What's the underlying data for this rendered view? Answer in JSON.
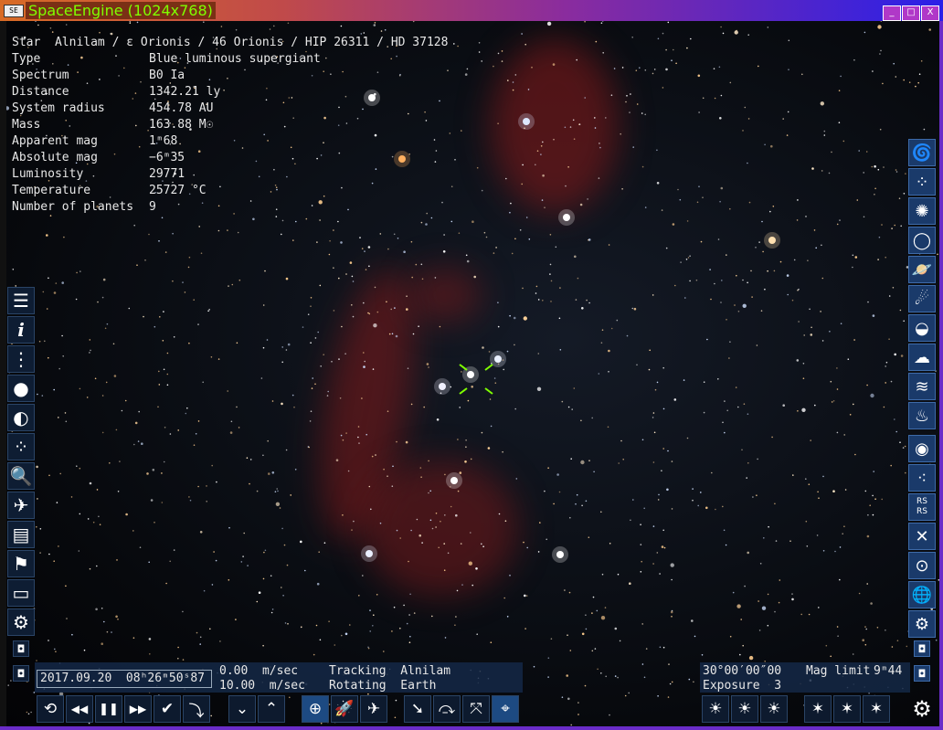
{
  "window": {
    "title": "SpaceEngine (1024x768)",
    "buttons": [
      "_",
      "□",
      "X"
    ]
  },
  "object_info": {
    "name_line": "Star  Alnilam / ε Orionis / 46 Orionis / HIP 26311 / HD 37128",
    "rows": [
      {
        "label": "Type",
        "value": "Blue luminous supergiant"
      },
      {
        "label": "Spectrum",
        "value": "B0 Ia"
      },
      {
        "label": "Distance",
        "value": "1342.21 ly"
      },
      {
        "label": "System radius",
        "value": "454.78 AU"
      },
      {
        "label": "Mass",
        "value": "163.88 M☉"
      },
      {
        "label": "Apparent mag",
        "value": "1ᵐ68"
      },
      {
        "label": "Absolute mag",
        "value": "−6ᵐ35"
      },
      {
        "label": "Luminosity",
        "value": "29771"
      },
      {
        "label": "Temperature",
        "value": "25727 °C"
      },
      {
        "label": "Number of planets",
        "value": "9"
      }
    ]
  },
  "left_toolbar": [
    {
      "name": "menu-icon",
      "glyph": "☰"
    },
    {
      "name": "info-icon",
      "glyph": "i"
    },
    {
      "name": "planetarium-icon",
      "glyph": "⋮"
    },
    {
      "name": "solar-system-browser-icon",
      "glyph": "●"
    },
    {
      "name": "star-browser-icon",
      "glyph": "◐"
    },
    {
      "name": "star-field-icon",
      "glyph": "⁘"
    },
    {
      "name": "search-icon",
      "glyph": "🔍"
    },
    {
      "name": "spaceship-icon",
      "glyph": "✈"
    },
    {
      "name": "calendar-icon",
      "glyph": "▤"
    },
    {
      "name": "flag-icon",
      "glyph": "⚑"
    },
    {
      "name": "display-icon",
      "glyph": "▭"
    },
    {
      "name": "settings-icon",
      "glyph": "⚙"
    },
    {
      "name": "small-toggle-icon",
      "glyph": "◘"
    },
    {
      "name": "small-toggle-icon-2",
      "glyph": "◘"
    }
  ],
  "right_toolbar": [
    {
      "name": "galaxies-icon",
      "glyph": "🌀"
    },
    {
      "name": "star-clusters-icon",
      "glyph": "⁘"
    },
    {
      "name": "nebulae-icon",
      "glyph": "✺"
    },
    {
      "name": "ring-icon",
      "glyph": "◯"
    },
    {
      "name": "planet-rings-icon",
      "glyph": "🪐"
    },
    {
      "name": "comet-icon",
      "glyph": "☄"
    },
    {
      "name": "atmosphere-icon",
      "glyph": "◒"
    },
    {
      "name": "clouds-icon",
      "glyph": "☁"
    },
    {
      "name": "water-icon",
      "glyph": "≋"
    },
    {
      "name": "aurora-icon",
      "glyph": "♨"
    },
    {
      "name": "eye-icon",
      "glyph": "◉"
    },
    {
      "name": "dots-icon",
      "glyph": "⁖"
    },
    {
      "name": "labels-icon",
      "glyph": "•"
    },
    {
      "name": "collapse-icon",
      "glyph": "✕"
    },
    {
      "name": "orbit-icon",
      "glyph": "⊙"
    },
    {
      "name": "grid-globe-icon",
      "glyph": "🌐"
    },
    {
      "name": "settings-icon",
      "glyph": "⚙"
    },
    {
      "name": "small-toggle-icon",
      "glyph": "◘"
    },
    {
      "name": "small-toggle-icon-2",
      "glyph": "◘"
    }
  ],
  "right_toolbar_rs": [
    "RS",
    "RS"
  ],
  "bottom_panel": {
    "date": "2017.09.20  08ʰ26ᵐ50ˢ87",
    "speed1": "0.00  m/sec",
    "speed2": "10.00  m/sec",
    "tracking": "Tracking  Alnilam",
    "rotating": "Rotating  Earth",
    "fov": "30°00′00″00",
    "mag_label": "Mag limit",
    "mag_value": "9ᵐ44",
    "exposure": "Exposure  3"
  },
  "bottom_buttons": [
    {
      "name": "reverse-time-icon",
      "glyph": "⟲"
    },
    {
      "name": "rewind-icon",
      "glyph": "◀◀"
    },
    {
      "name": "pause-icon",
      "glyph": "❚❚"
    },
    {
      "name": "fast-forward-icon",
      "glyph": "▶▶"
    },
    {
      "name": "realtime-check-icon",
      "glyph": "✔"
    },
    {
      "name": "current-time-icon",
      "glyph": "⤵"
    },
    {
      "name": "speed-down-icon",
      "glyph": "⌄"
    },
    {
      "name": "speed-up-icon",
      "glyph": "⌃"
    },
    {
      "name": "free-mode-icon",
      "glyph": "⊕"
    },
    {
      "name": "rocket-icon",
      "glyph": "🚀"
    },
    {
      "name": "airplane-icon",
      "glyph": "✈"
    },
    {
      "name": "goto-icon",
      "glyph": "➘"
    },
    {
      "name": "land-icon",
      "glyph": "⤼"
    },
    {
      "name": "fullscreen-icon",
      "glyph": "⤧"
    },
    {
      "name": "center-target-icon",
      "glyph": "⌖"
    },
    {
      "name": "exposure-down-icon",
      "glyph": "☀"
    },
    {
      "name": "exposure-reset-icon",
      "glyph": "☀"
    },
    {
      "name": "exposure-up-icon",
      "glyph": "☀"
    },
    {
      "name": "mag-limit-down-icon",
      "glyph": "✶"
    },
    {
      "name": "mag-limit-reset-icon",
      "glyph": "✶"
    },
    {
      "name": "mag-limit-up-icon",
      "glyph": "✶"
    },
    {
      "name": "settings-icon",
      "glyph": "⚙"
    }
  ],
  "colors": {
    "accent": "#7fff00",
    "panel": "#14284a",
    "nebula_red": "#8b1a1a"
  }
}
